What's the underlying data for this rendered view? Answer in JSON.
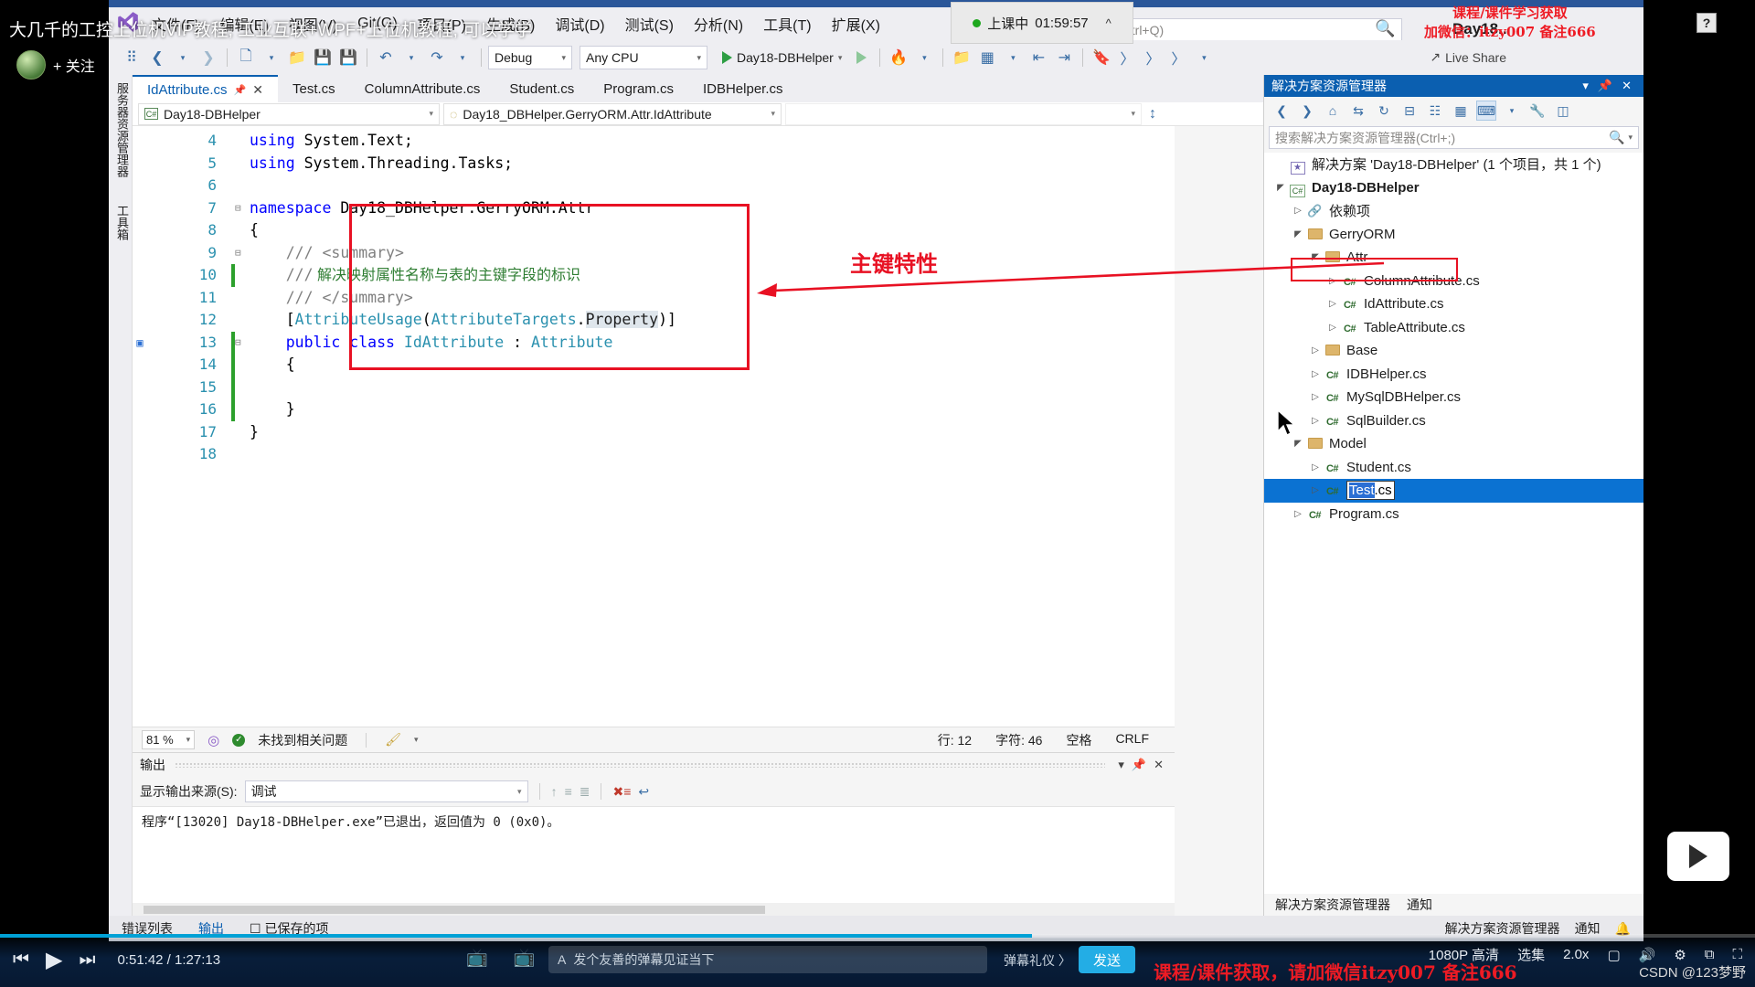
{
  "overlay": {
    "top_text": "大几千的工控上位机VIP教程, 工业互联+WPF+上位机教程, 可以学学",
    "follow_label": "+ 关注",
    "help_badge": "?",
    "promo_line1": "课程/课件学习获取",
    "promo_line2": "加微信：itzy007 备注666",
    "promo_bottom": "课程/课件获取，请加微信itzy007 备注666",
    "watermark": "CSDN @123梦野"
  },
  "class_timer": {
    "status": "上课中",
    "elapsed": "01:59:57",
    "chevron": "chevron-up"
  },
  "menubar": {
    "items": [
      "文件(F)",
      "编辑(E)",
      "视图(V)",
      "Git(G)",
      "项目(P)",
      "生成(B)",
      "调试(D)",
      "测试(S)",
      "分析(N)",
      "工具(T)",
      "扩展(X)"
    ],
    "search_placeholder": "(Ctrl+Q)",
    "window_title": "Day18.."
  },
  "toolbar": {
    "config": "Debug",
    "platform": "Any CPU",
    "run_target": "Day18-DBHelper",
    "live_share": "Live Share"
  },
  "tabs": [
    {
      "label": "IdAttribute.cs",
      "active": true,
      "pinned": true,
      "closeable": true
    },
    {
      "label": "Test.cs",
      "active": false
    },
    {
      "label": "ColumnAttribute.cs",
      "active": false
    },
    {
      "label": "Student.cs",
      "active": false
    },
    {
      "label": "Program.cs",
      "active": false
    },
    {
      "label": "IDBHelper.cs",
      "active": false
    }
  ],
  "vertical_tabs": [
    "服务器资源管理器",
    "工具箱"
  ],
  "navbar": {
    "project": "Day18-DBHelper",
    "member": "Day18_DBHelper.GerryORM.Attr.IdAttribute"
  },
  "code": {
    "lines": [
      {
        "n": "4",
        "changed": false,
        "text": "using System.Text;"
      },
      {
        "n": "5",
        "changed": false,
        "text": "using System.Threading.Tasks;"
      },
      {
        "n": "6",
        "changed": false,
        "text": ""
      },
      {
        "n": "7",
        "changed": false,
        "text": "namespace Day18_DBHelper.GerryORM.Attr"
      },
      {
        "n": "8",
        "changed": false,
        "text": "{"
      },
      {
        "n": "9",
        "changed": false,
        "text": "    /// <summary>"
      },
      {
        "n": "10",
        "changed": true,
        "text": "    /// 解决映射属性名称与表的主键字段的标识"
      },
      {
        "n": "11",
        "changed": false,
        "text": "    /// </summary>"
      },
      {
        "n": "12",
        "changed": false,
        "text": "    [AttributeUsage(AttributeTargets.Property)]"
      },
      {
        "n": "13",
        "changed": true,
        "text": "    public class IdAttribute : Attribute"
      },
      {
        "n": "14",
        "changed": true,
        "text": "    {"
      },
      {
        "n": "15",
        "changed": true,
        "text": ""
      },
      {
        "n": "16",
        "changed": true,
        "text": "    }"
      },
      {
        "n": "17",
        "changed": false,
        "text": "}"
      },
      {
        "n": "18",
        "changed": false,
        "text": ""
      }
    ],
    "annotation": "主键特性"
  },
  "editor_status": {
    "zoom": "81 %",
    "issues": "未找到相关问题",
    "line_label": "行: 12",
    "char_label": "字符: 46",
    "indent": "空格",
    "eol": "CRLF"
  },
  "output": {
    "title": "输出",
    "source_label": "显示输出来源(S):",
    "source_value": "调试",
    "body": "程序“[13020] Day18-DBHelper.exe”已退出，返回值为 0 (0x0)。"
  },
  "vs_status": {
    "tabs": [
      "错误列表",
      "输出"
    ],
    "saved": "已保存的项",
    "right_tabs": [
      "解决方案资源管理器",
      "通知"
    ]
  },
  "solution_explorer": {
    "title": "解决方案资源管理器",
    "search_placeholder": "搜索解决方案资源管理器(Ctrl+;)",
    "bottom_tabs": [
      "解决方案资源管理器",
      "通知"
    ],
    "tree": [
      {
        "depth": 0,
        "expander": "",
        "icon": "solution-icon",
        "label": "解决方案 'Day18-DBHelper' (1 个项目，共 1 个)",
        "bold": false
      },
      {
        "depth": 0,
        "expander": "▲",
        "icon": "project-icon",
        "label": "Day18-DBHelper",
        "bold": true
      },
      {
        "depth": 1,
        "expander": "▷",
        "icon": "dependencies-icon",
        "label": "依赖项",
        "bold": false
      },
      {
        "depth": 1,
        "expander": "▲",
        "icon": "folder-icon",
        "label": "GerryORM",
        "bold": false
      },
      {
        "depth": 2,
        "expander": "▲",
        "icon": "folder-icon",
        "label": "Attr",
        "bold": false
      },
      {
        "depth": 3,
        "expander": "▷",
        "icon": "csharp-icon",
        "label": "ColumnAttribute.cs",
        "bold": false
      },
      {
        "depth": 3,
        "expander": "▷",
        "icon": "csharp-icon",
        "label": "IdAttribute.cs",
        "bold": false,
        "highlight": true
      },
      {
        "depth": 3,
        "expander": "▷",
        "icon": "csharp-icon",
        "label": "TableAttribute.cs",
        "bold": false
      },
      {
        "depth": 2,
        "expander": "▷",
        "icon": "folder-icon",
        "label": "Base",
        "bold": false
      },
      {
        "depth": 2,
        "expander": "▷",
        "icon": "csharp-icon",
        "label": "IDBHelper.cs",
        "bold": false
      },
      {
        "depth": 2,
        "expander": "▷",
        "icon": "csharp-icon",
        "label": "MySqlDBHelper.cs",
        "bold": false
      },
      {
        "depth": 2,
        "expander": "▷",
        "icon": "csharp-icon",
        "label": "SqlBuilder.cs",
        "bold": false
      },
      {
        "depth": 1,
        "expander": "▲",
        "icon": "folder-icon",
        "label": "Model",
        "bold": false
      },
      {
        "depth": 2,
        "expander": "▷",
        "icon": "csharp-icon",
        "label": "Student.cs",
        "bold": false
      },
      {
        "depth": 2,
        "expander": "▷",
        "icon": "csharp-icon",
        "label": "Test.cs",
        "bold": false,
        "selected": true,
        "renaming": true,
        "rename_selected": "Test",
        "rename_rest": ".cs"
      },
      {
        "depth": 1,
        "expander": "▷",
        "icon": "csharp-icon",
        "label": "Program.cs",
        "bold": false
      }
    ]
  },
  "player": {
    "time_current": "0:51:42",
    "time_total": "1:27:13",
    "time_display": "0:51:42 / 1:27:13",
    "danmu_placeholder": "发个友善的弹幕见证当下",
    "danmu_rule": "弹幕礼仪 〉",
    "send_label": "发送",
    "quality": "1080P 高清",
    "episodes": "选集",
    "speed": "2.0x",
    "progress_percent": 58.8
  },
  "colors": {
    "accent_blue": "#0b5fb0",
    "promo_red": "#ee1b24",
    "annotation_red": "#e81123",
    "bili_blue": "#00a1d6",
    "selection_blue": "#0b72d2",
    "changed_green": "#2ca02c"
  }
}
